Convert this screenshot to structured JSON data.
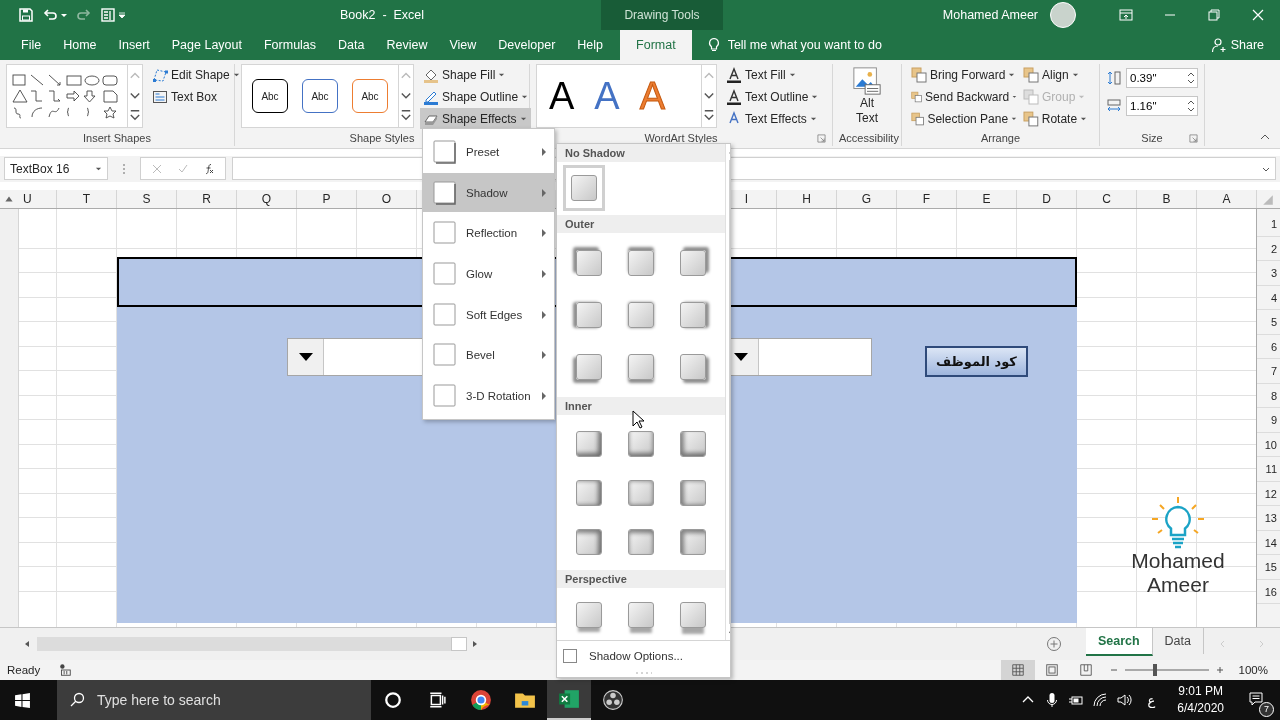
{
  "title_bar": {
    "title": "Book2  -  Excel",
    "context_label": "Drawing Tools",
    "user": "Mohamed Ameer"
  },
  "tabs": [
    {
      "label": "File",
      "selected": false
    },
    {
      "label": "Home",
      "selected": false
    },
    {
      "label": "Insert",
      "selected": false
    },
    {
      "label": "Page Layout",
      "selected": false
    },
    {
      "label": "Formulas",
      "selected": false
    },
    {
      "label": "Data",
      "selected": false
    },
    {
      "label": "Review",
      "selected": false
    },
    {
      "label": "View",
      "selected": false
    },
    {
      "label": "Developer",
      "selected": false
    },
    {
      "label": "Help",
      "selected": false
    },
    {
      "label": "Format",
      "selected": true
    }
  ],
  "tell_me": "Tell me what you want to do",
  "share": "Share",
  "ribbon": {
    "insert_shapes": {
      "label": "Insert Shapes",
      "buttons": [
        "Edit Shape",
        "Text Box"
      ]
    },
    "shape_styles": {
      "label": "Shape Styles",
      "samples": [
        {
          "text": "Abc",
          "color": "#000000"
        },
        {
          "text": "Abc",
          "color": "#4472c4"
        },
        {
          "text": "Abc",
          "color": "#ed7d31"
        }
      ],
      "buttons": [
        {
          "label": "Shape Fill",
          "expanded": false
        },
        {
          "label": "Shape Outline",
          "expanded": false
        },
        {
          "label": "Shape Effects",
          "expanded": true
        }
      ]
    },
    "wordart_styles": {
      "label": "WordArt Styles",
      "samples": [
        {
          "text": "A",
          "color": "#000000"
        },
        {
          "text": "A",
          "color": "#4472c4"
        },
        {
          "text": "A",
          "color": "#ed7d31"
        }
      ],
      "buttons": [
        "Text Fill",
        "Text Outline",
        "Text Effects"
      ]
    },
    "accessibility": {
      "label": "Accessibility",
      "button": "Alt Text"
    },
    "arrange": {
      "label": "Arrange",
      "buttons": [
        {
          "label": "Bring Forward",
          "disabled": false
        },
        {
          "label": "Send Backward",
          "disabled": false
        },
        {
          "label": "Selection Pane",
          "disabled": false
        },
        {
          "label": "Align",
          "disabled": false
        },
        {
          "label": "Group",
          "disabled": true
        },
        {
          "label": "Rotate",
          "disabled": false
        }
      ]
    },
    "size": {
      "label": "Size",
      "height": "0.39\"",
      "width": "1.16\""
    }
  },
  "formula_bar": {
    "name_box": "TextBox 16"
  },
  "columns_left": [
    "U",
    "T",
    "S",
    "R",
    "Q",
    "P",
    "O"
  ],
  "columns_right": [
    "I",
    "H",
    "G",
    "F",
    "E",
    "D",
    "C",
    "B",
    "A"
  ],
  "rows": [
    "1",
    "2",
    "3",
    "4",
    "5",
    "6",
    "7",
    "8",
    "9",
    "10",
    "11",
    "12",
    "13",
    "14",
    "15",
    "16"
  ],
  "sheet": {
    "label_button": "كود الموظف",
    "logo_text": "Mohamed Ameer"
  },
  "sheet_tabs": [
    {
      "label": "Search",
      "selected": true
    },
    {
      "label": "Data",
      "selected": false
    }
  ],
  "status_bar": {
    "ready": "Ready",
    "zoom": "100%",
    "zoom_slider": {
      "level": 0.36
    }
  },
  "effects_menu": [
    {
      "label": "Preset",
      "selected": false
    },
    {
      "label": "Shadow",
      "selected": true
    },
    {
      "label": "Reflection",
      "selected": false
    },
    {
      "label": "Glow",
      "selected": false
    },
    {
      "label": "Soft Edges",
      "selected": false
    },
    {
      "label": "Bevel",
      "selected": false
    },
    {
      "label": "3-D Rotation",
      "selected": false
    }
  ],
  "shadow_menu": {
    "sections": [
      {
        "title": "No Shadow",
        "kind": "none",
        "tiles": [
          {
            "selected": true
          }
        ]
      },
      {
        "title": "Outer",
        "kind": "outer",
        "tiles": [
          {
            "selected": false
          },
          {
            "selected": false
          },
          {
            "selected": false
          },
          {
            "selected": false
          },
          {
            "selected": false
          },
          {
            "selected": false
          },
          {
            "selected": false
          },
          {
            "selected": false
          },
          {
            "selected": false
          }
        ]
      },
      {
        "title": "Inner",
        "kind": "inner",
        "tiles": [
          {
            "selected": false
          },
          {
            "selected": false
          },
          {
            "selected": false
          },
          {
            "selected": false
          },
          {
            "selected": false
          },
          {
            "selected": false
          },
          {
            "selected": false
          },
          {
            "selected": false
          },
          {
            "selected": false
          }
        ]
      },
      {
        "title": "Perspective",
        "kind": "perspective",
        "tiles": [
          {
            "selected": false
          },
          {
            "selected": false
          },
          {
            "selected": false
          }
        ]
      }
    ],
    "options": {
      "label": "Shadow Options...",
      "checked": false
    }
  },
  "taskbar": {
    "search_placeholder": "Type here to search",
    "language": "ع",
    "time": "9:01 PM",
    "date": "6/4/2020",
    "notifications": "7"
  }
}
